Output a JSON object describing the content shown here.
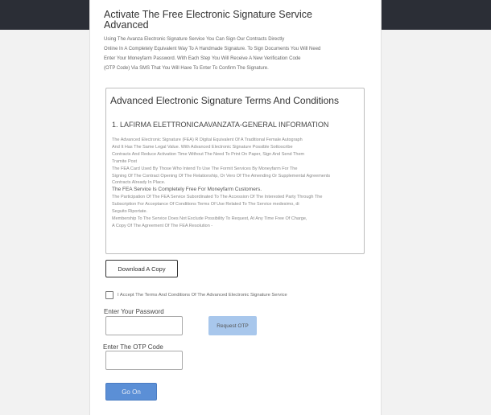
{
  "page": {
    "title": "Activate The Free Electronic Signature Service Advanced",
    "intro_lines": [
      "Using The Avanza Electronic Signature Service You Can Sign Our Contracts Directly",
      "Online In A Completely Equivalent Way To A Handmade Signature. To Sign Documents You Will Need",
      "Enter Your Moneyfarm Password. With Each Step You Will Receive A New Verification Code",
      "(OTP Code) Via SMS That You Will Have To Enter To Confirm The Signature."
    ]
  },
  "terms": {
    "title": "Advanced Electronic Signature Terms And Conditions",
    "section_heading": "1. LAFIRMA ELETTRONICAAVANZATA-GENERAL INFORMATION",
    "paragraphs": [
      "The Advanced Electronic Signature (FEA) R Digital Equivalent Of A Traditional Female Autograph",
      "And It Has The Same Legal Value. With Advanced Electronic Signature Possible Sottoscribe",
      "Contracts And Reduce Activation Time Without The Need To Print On Paper, Sign And Send Them",
      "Tramite Post",
      "The FEA Card Used By Those Who Intend To Use The Formit Services By Moneyfarm For The",
      "Signing Of The Contract Opening Of The Relationship, Or Vero Of The Amending Or Supplemental Agreements",
      "Contracts Already In Place.",
      "The FEA Service Is Completely Free For Moneyfarm Customers.",
      "The Participation Of The FEA Service Subordinated To The Accession Of The Interested Party Through The",
      "Subscription For Acceptance Of Conditions Terms Of Use Related To The Service medesimo, di",
      "Seguito Riportate.",
      "Membership To The Service Does Not Exclude Possibility To Request, At Any Time Free Of Charge,",
      "A Copy Of The Agreement Of The FEA Resolution -"
    ]
  },
  "actions": {
    "download_label": "Download A Copy",
    "accept_label": "I Accept The Terms And Conditions Of The Advanced Electronic Signature Service",
    "password_label": "Enter Your Password",
    "password_value": "",
    "request_otp_label": "Request OTP",
    "otp_label": "Enter The OTP Code",
    "otp_value": "",
    "go_label": "Go On"
  },
  "colors": {
    "topbar": "#2b2e36",
    "otp_button": "#a8c7ec",
    "go_button": "#5b8fd6"
  }
}
